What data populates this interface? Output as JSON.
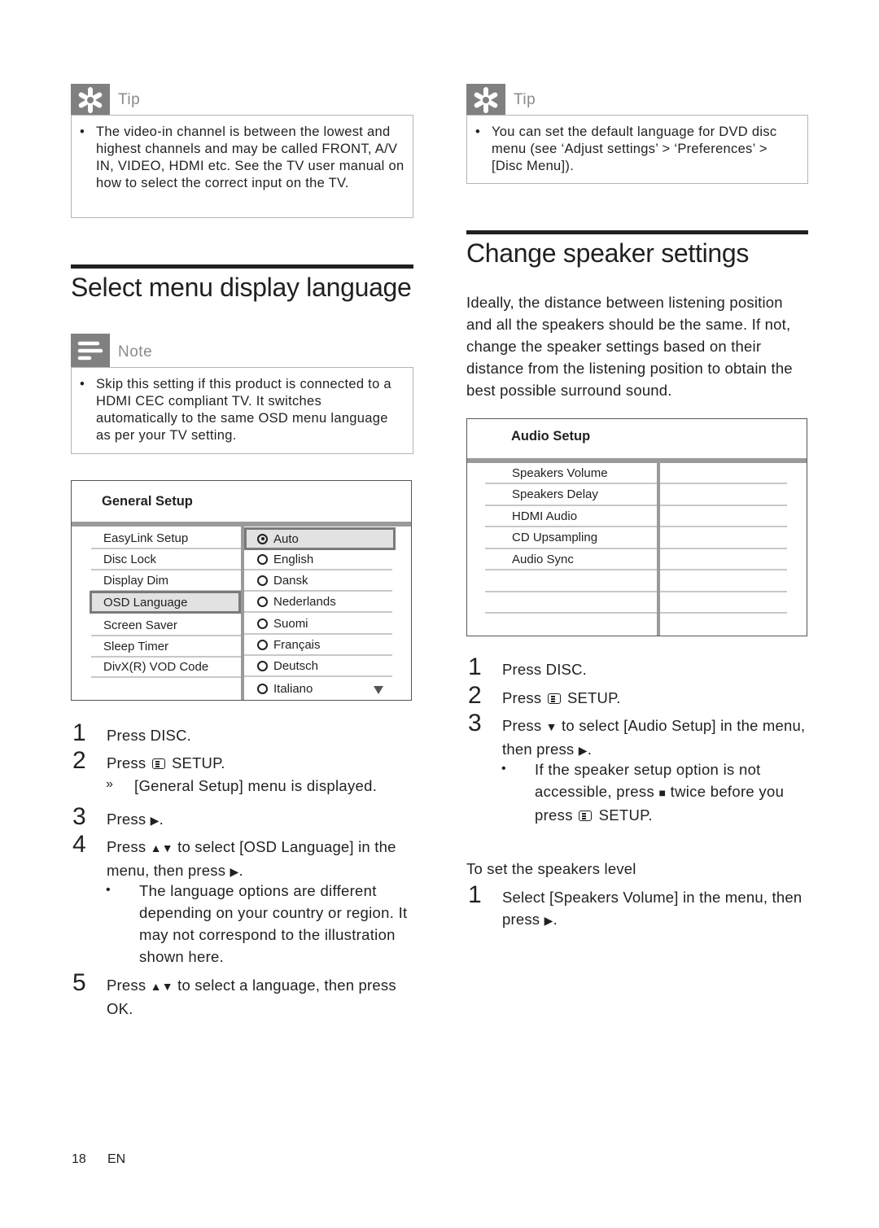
{
  "left": {
    "tip": {
      "title": "Tip",
      "icon": "asterisk-icon",
      "bullets": [
        "The video-in channel is between the lowest and highest channels and may be called FRONT, A/V IN, VIDEO, HDMI etc. See the TV user manual on how to select the correct input on the TV."
      ]
    },
    "section_title": "Select menu display language",
    "note": {
      "title": "Note",
      "icon": "note-lines-icon",
      "bullets": [
        "Skip this setting if this product is connected to a HDMI CEC compliant TV. It switches automatically to the same OSD menu language as per your TV setting."
      ]
    },
    "screen": {
      "title": "General Setup",
      "menu_items": [
        "EasyLink Setup",
        "Disc Lock",
        "Display Dim",
        "OSD Language",
        "Screen Saver",
        "Sleep Timer",
        "DivX(R) VOD Code"
      ],
      "selected_menu_item": "OSD Language",
      "options": [
        "Auto",
        "English",
        "Dansk",
        "Nederlands",
        "Suomi",
        "Français",
        "Deutsch",
        "Italiano"
      ],
      "selected_option": "Auto",
      "scroll_indicator": "scroll-down-icon"
    },
    "steps": [
      {
        "num": "1",
        "pre": "Press DISC.",
        "icon": null,
        "post": ""
      },
      {
        "num": "2",
        "pre": "Press ",
        "icon": "setup-icon",
        "post": " SETUP."
      },
      {
        "num": "3",
        "pre": "Press ",
        "icon": "right-arrow-icon",
        "post": "."
      },
      {
        "num": "4",
        "pre": "Press ",
        "icon": "up-down-arrow-icon",
        "post": " to select [OSD Language] in the menu, then press ",
        "icon2": "right-arrow-icon",
        "post2": "."
      },
      {
        "num": "5",
        "pre": "Press ",
        "icon": "up-down-arrow-icon",
        "post": " to select a language, then press OK."
      }
    ],
    "step2_result_marker": "»",
    "step2_result": "[General Setup] menu is displayed.",
    "step4_bullet": "The language options are different depending on your country or region. It may not correspond to the illustration shown here."
  },
  "right": {
    "tip": {
      "title": "Tip",
      "icon": "asterisk-icon",
      "bullets": [
        "You can set the default language for DVD disc menu (see ‘Adjust settings’ > ‘Preferences’ > [Disc Menu])."
      ]
    },
    "section_title": "Change speaker settings",
    "intro": "Ideally, the distance between listening position and all the speakers should be the same. If not, change the speaker settings based on their distance from the listening position to obtain the best possible surround sound.",
    "screen": {
      "title": "Audio Setup",
      "menu_items": [
        "Speakers Volume",
        "Speakers Delay",
        "HDMI Audio",
        "CD Upsampling",
        "Audio Sync",
        "",
        "",
        ""
      ]
    },
    "steps": [
      {
        "num": "1",
        "pre": "Press DISC."
      },
      {
        "num": "2",
        "pre": "Press ",
        "post": " SETUP."
      },
      {
        "num": "3",
        "pre": "Press ",
        "post": " to select [Audio Setup] in the menu, then press ",
        "post2": "."
      }
    ],
    "step3_bullet_pre": "If the speaker setup option is not accessible, press ",
    "step3_bullet_mid": " twice before you press ",
    "step3_bullet_post": " SETUP.",
    "subheading": "To set the speakers level",
    "level_steps": [
      {
        "num": "1",
        "pre": "Select [Speakers Volume] in the menu, then press ",
        "post": "."
      }
    ]
  },
  "footer": {
    "page_number": "18",
    "language": "EN"
  },
  "glyphs": {
    "right": "▶",
    "down": "▼",
    "updown": "▲▼",
    "stop": "■",
    "bullet": "•"
  }
}
